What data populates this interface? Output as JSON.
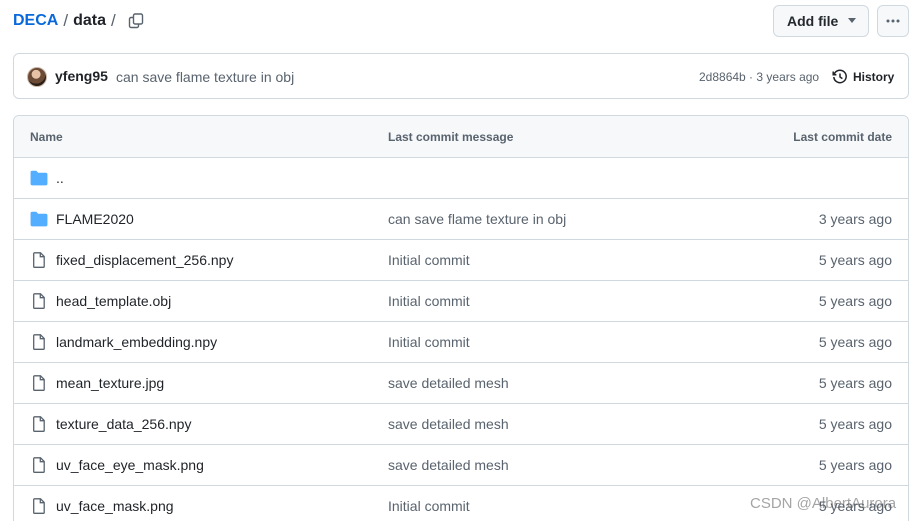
{
  "breadcrumb": {
    "repo": "DECA",
    "separator": "/",
    "current": "data",
    "trailing": "/"
  },
  "toolbar": {
    "add_file_label": "Add file",
    "more_icon": "kebab-horizontal-icon",
    "copy_icon": "copy-icon"
  },
  "commit": {
    "author": "yfeng95",
    "message": "can save flame texture in obj",
    "sha_age": "2d8864b · 3 years ago",
    "history_label": "History"
  },
  "table": {
    "headers": {
      "name": "Name",
      "message": "Last commit message",
      "date": "Last commit date"
    },
    "rows": [
      {
        "type": "dir",
        "name": "..",
        "message": "",
        "date": ""
      },
      {
        "type": "dir",
        "name": "FLAME2020",
        "message": "can save flame texture in obj",
        "date": "3 years ago"
      },
      {
        "type": "file",
        "name": "fixed_displacement_256.npy",
        "message": "Initial commit",
        "date": "5 years ago"
      },
      {
        "type": "file",
        "name": "head_template.obj",
        "message": "Initial commit",
        "date": "5 years ago"
      },
      {
        "type": "file",
        "name": "landmark_embedding.npy",
        "message": "Initial commit",
        "date": "5 years ago"
      },
      {
        "type": "file",
        "name": "mean_texture.jpg",
        "message": "save detailed mesh",
        "date": "5 years ago"
      },
      {
        "type": "file",
        "name": "texture_data_256.npy",
        "message": "save detailed mesh",
        "date": "5 years ago"
      },
      {
        "type": "file",
        "name": "uv_face_eye_mask.png",
        "message": "save detailed mesh",
        "date": "5 years ago"
      },
      {
        "type": "file",
        "name": "uv_face_mask.png",
        "message": "Initial commit",
        "date": "5 years ago"
      }
    ]
  },
  "watermark": "CSDN @AlbertAurora",
  "colors": {
    "link": "#0969da",
    "folder": "#54aeff",
    "muted": "#59636e",
    "border": "#d1d9e0"
  }
}
